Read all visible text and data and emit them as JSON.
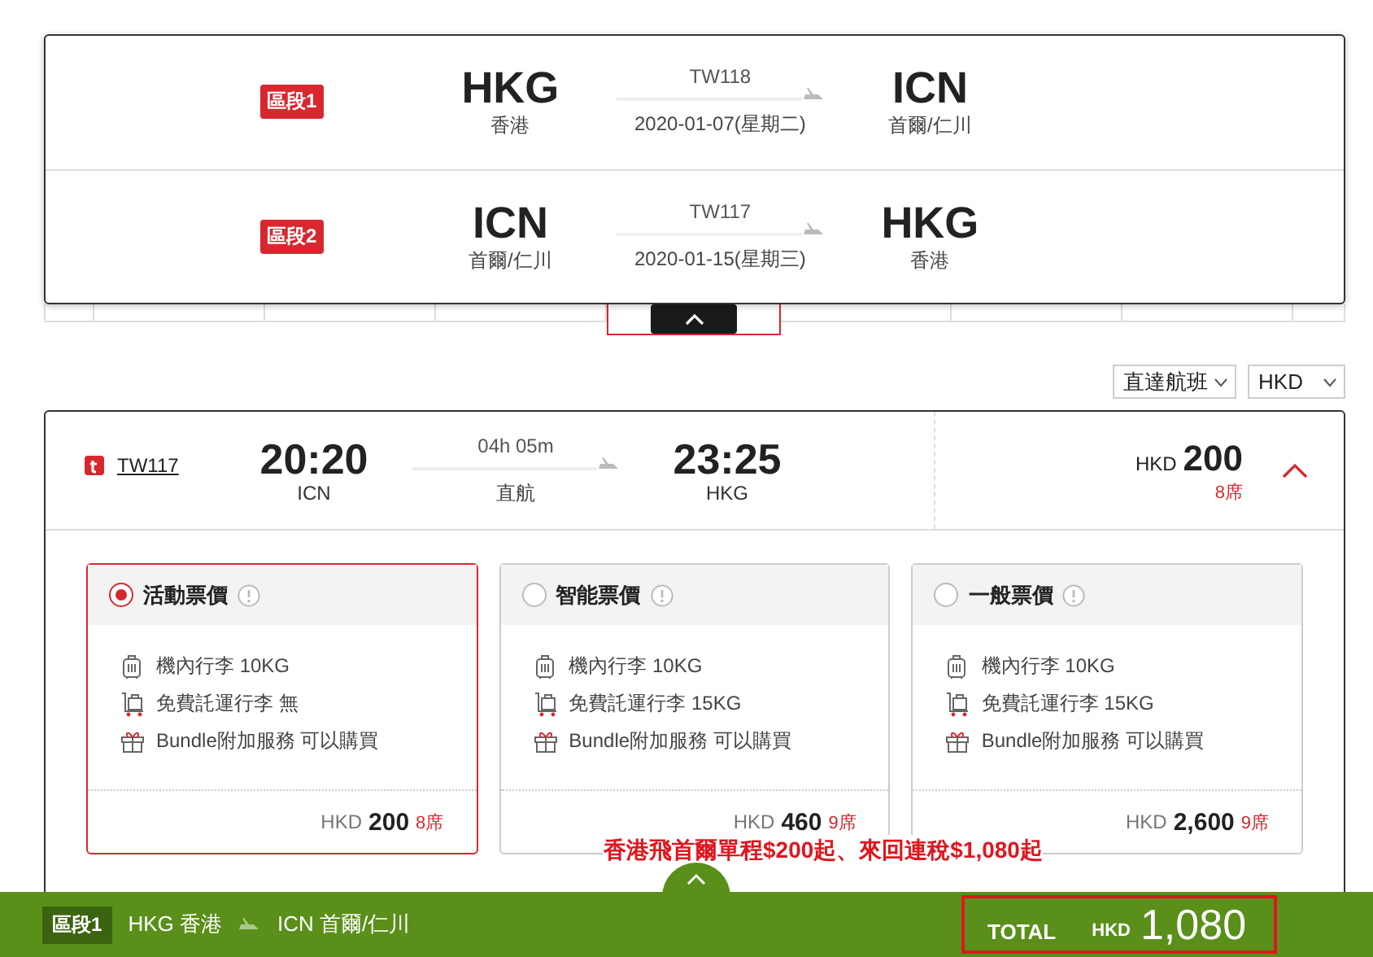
{
  "segments": [
    {
      "label": "區段1",
      "from_code": "HKG",
      "from_city": "香港",
      "flight": "TW118",
      "date": "2020-01-07(星期二)",
      "to_code": "ICN",
      "to_city": "首爾/仁川"
    },
    {
      "label": "區段2",
      "from_code": "ICN",
      "from_city": "首爾/仁川",
      "flight": "TW117",
      "date": "2020-01-15(星期三)",
      "to_code": "HKG",
      "to_city": "香港"
    }
  ],
  "filters": [
    {
      "label": "直達航班"
    },
    {
      "label": "HKD"
    }
  ],
  "flight": {
    "number": "TW117",
    "depart_time": "20:20",
    "depart_code": "ICN",
    "duration": "04h 05m",
    "stops": "直航",
    "arrive_time": "23:25",
    "arrive_code": "HKG",
    "currency": "HKD",
    "price": "200",
    "seats": "8席",
    "expanded": true
  },
  "fares": [
    {
      "name": "活動票價",
      "selected": true,
      "features": [
        {
          "kind": "cabin",
          "text": "機內行李 10KG"
        },
        {
          "kind": "checked",
          "text": "免費託運行李 無"
        },
        {
          "kind": "bundle",
          "text": "Bundle附加服務 可以購買"
        }
      ],
      "currency": "HKD",
      "price": "200",
      "seats": "8席"
    },
    {
      "name": "智能票價",
      "selected": false,
      "features": [
        {
          "kind": "cabin",
          "text": "機內行李 10KG"
        },
        {
          "kind": "checked",
          "text": "免費託運行李 15KG"
        },
        {
          "kind": "bundle",
          "text": "Bundle附加服務 可以購買"
        }
      ],
      "currency": "HKD",
      "price": "460",
      "seats": "9席"
    },
    {
      "name": "一般票價",
      "selected": false,
      "features": [
        {
          "kind": "cabin",
          "text": "機內行李 10KG"
        },
        {
          "kind": "checked",
          "text": "免費託運行李 15KG"
        },
        {
          "kind": "bundle",
          "text": "Bundle附加服務 可以購買"
        }
      ],
      "currency": "HKD",
      "price": "2,600",
      "seats": "9席"
    }
  ],
  "promo": "香港飛首爾單程$200起、來回連稅$1,080起",
  "summary": {
    "label": "區段1",
    "from": "HKG 香港",
    "to": "ICN 首爾/仁川",
    "total_label": "TOTAL",
    "currency": "HKD",
    "total": "1,080"
  }
}
